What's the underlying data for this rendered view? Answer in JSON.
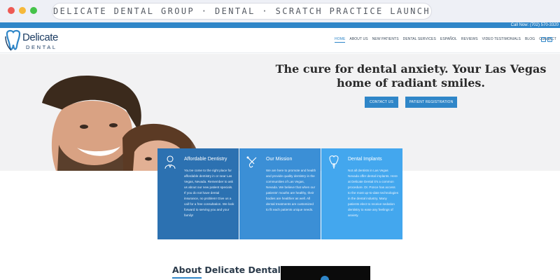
{
  "browser": {
    "address_text": "DELICATE DENTAL GROUP · DENTAL · SCRATCH PRACTICE LAUNCH"
  },
  "topbar": {
    "call_now": "Call Now: (702) 570-3320"
  },
  "logo": {
    "name": "Delicate",
    "sub": "DENTAL"
  },
  "nav": {
    "items": [
      "HOME",
      "ABOUT US",
      "NEW PATIENTS",
      "DENTAL SERVICES",
      "ESPAÑOL",
      "REVIEWS",
      "VIDEO TESTIMONIALS",
      "BLOG",
      "CONTACT"
    ],
    "active": "HOME"
  },
  "social": {
    "icons": [
      "facebook-icon",
      "instagram-icon"
    ]
  },
  "hero": {
    "title": "The cure for dental anxiety. Your Las Vegas home of radiant smiles.",
    "contact_button": "CONTACT US",
    "register_button": "PATIENT REGISTRATION"
  },
  "cards": [
    {
      "title": "Affordable Dentistry",
      "icon": "dentist-person-icon",
      "text": "You've come to the right place for affordable dentistry in or near Las Vegas, Nevada. Remember to ask us about our new patient specials. If you do not have dental insurance, no problem! Give us a call for a free consultation. We look forward to serving you and your family!"
    },
    {
      "title": "Our Mission",
      "icon": "dental-tools-icon",
      "text": "We are here to promote and health and provide quality dentistry in the communities of Las Vegas, Nevada. We believe that when our patients' mouths are healthy, their bodies are healthier as well. All dental treatments are customized to fit each patients unique needs."
    },
    {
      "title": "Dental Implants",
      "icon": "tooth-implant-icon",
      "text": "Not all dentists in Las Vegas Nevada offer dental implants. Here at Delicate Dental it's a common procedure. Dr. Ponce has access to the most up-to-date technologies in the dental industry. Many patients elect to receive sedation dentistry to ease any feelings of anxiety."
    }
  ],
  "about": {
    "title": "About Delicate Dental"
  },
  "colors": {
    "brand_blue": "#2f86c8",
    "card_dark": "#2c71b1",
    "card_mid": "#3b8fd6",
    "card_light": "#43a7ee",
    "logo_navy": "#1d3d63"
  }
}
